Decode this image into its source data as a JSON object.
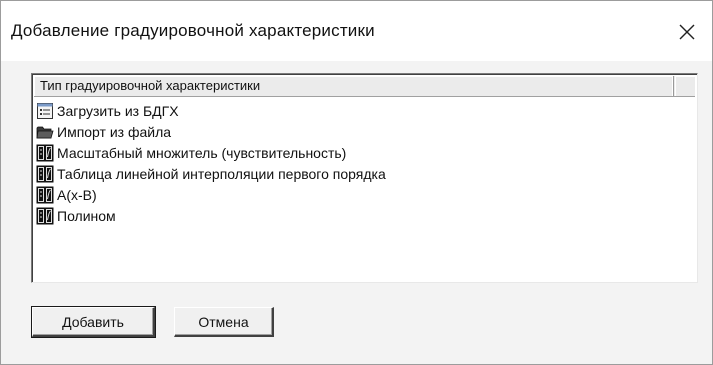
{
  "window": {
    "title": "Добавление градуировочной  характеристики",
    "close_icon": "close-icon"
  },
  "list": {
    "column_header": "Тип градуировочной характеристики",
    "items": [
      {
        "label": "Загрузить из БДГХ",
        "icon": "database-list-icon"
      },
      {
        "label": "Импорт из файла",
        "icon": "folder-icon"
      },
      {
        "label": "Масштабный множитель (чувствительность)",
        "icon": "characteristic-icon"
      },
      {
        "label": "Таблица линейной интерполяции первого порядка",
        "icon": "characteristic-icon"
      },
      {
        "label": "A(x-B)",
        "icon": "characteristic-icon"
      },
      {
        "label": "Полином",
        "icon": "characteristic-icon"
      }
    ]
  },
  "buttons": {
    "add_label": "Добавить",
    "cancel_label": "Отмена"
  }
}
